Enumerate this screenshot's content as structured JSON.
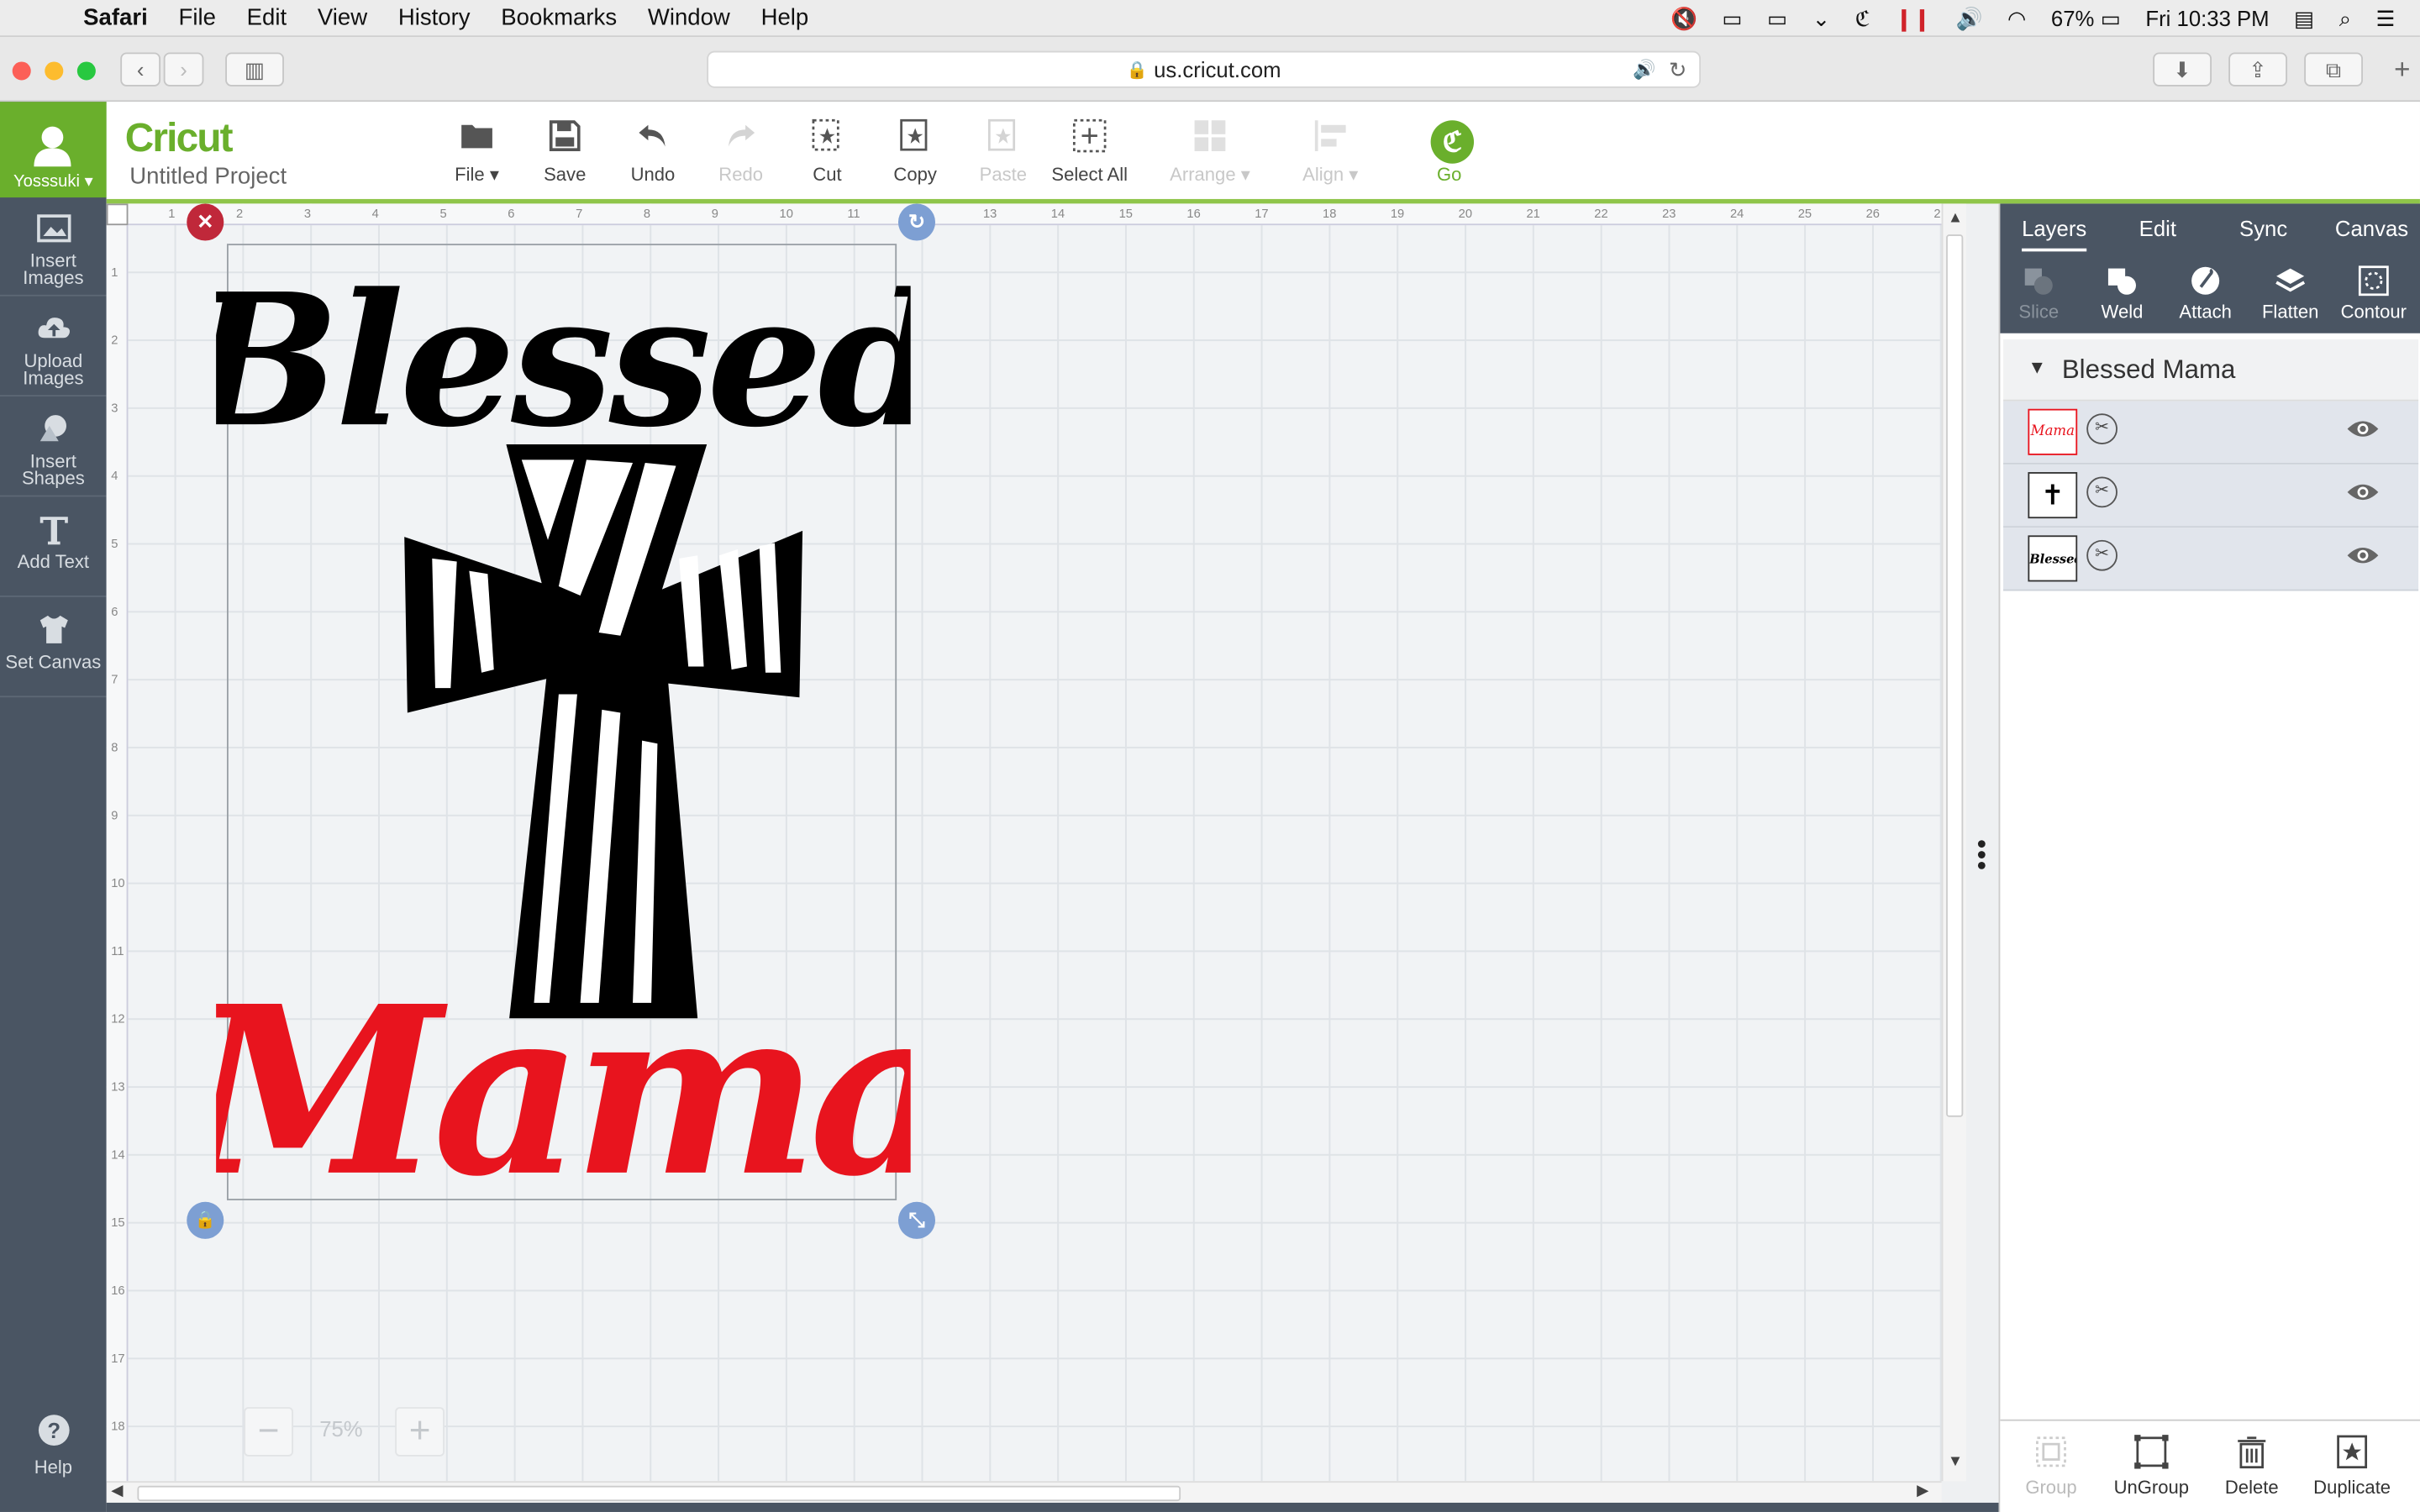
{
  "menubar": {
    "app": "Safari",
    "items": [
      "File",
      "Edit",
      "View",
      "History",
      "Bookmarks",
      "Window",
      "Help"
    ],
    "battery": "67%",
    "clock": "Fri 10:33 PM"
  },
  "browser": {
    "url": "us.cricut.com"
  },
  "sidebar": {
    "username": "Yosssuki",
    "items": [
      {
        "label_line1": "Insert",
        "label_line2": "Images",
        "icon": "image-icon"
      },
      {
        "label_line1": "Upload",
        "label_line2": "Images",
        "icon": "cloud-upload-icon"
      },
      {
        "label_line1": "Insert",
        "label_line2": "Shapes",
        "icon": "shapes-icon"
      },
      {
        "label_line1": "Add Text",
        "label_line2": "",
        "icon": "text-icon"
      },
      {
        "label_line1": "Set Canvas",
        "label_line2": "",
        "icon": "shirt-icon"
      }
    ],
    "help": "Help"
  },
  "header": {
    "brand": "Cricut",
    "project_name": "Untitled Project",
    "tools": [
      {
        "label": "File",
        "enabled": true
      },
      {
        "label": "Save",
        "enabled": true
      },
      {
        "label": "Undo",
        "enabled": true
      },
      {
        "label": "Redo",
        "enabled": false
      },
      {
        "label": "Cut",
        "enabled": true
      },
      {
        "label": "Copy",
        "enabled": true
      },
      {
        "label": "Paste",
        "enabled": false
      },
      {
        "label": "Select All",
        "enabled": true
      },
      {
        "label": "Arrange",
        "enabled": false
      },
      {
        "label": "Align",
        "enabled": false
      }
    ],
    "go_label": "Go"
  },
  "canvas": {
    "design_text_top": "Blessed",
    "design_text_bottom": "Mama",
    "zoom": "75%",
    "ruler_top": [
      "1",
      "2",
      "3",
      "4",
      "5",
      "6",
      "7",
      "8",
      "9",
      "10",
      "11",
      "12",
      "13",
      "14",
      "15",
      "16",
      "17",
      "18",
      "19",
      "20",
      "21",
      "22",
      "23",
      "24",
      "25",
      "26",
      "2"
    ],
    "ruler_left": [
      "1",
      "2",
      "3",
      "4",
      "5",
      "6",
      "7",
      "8",
      "9",
      "10",
      "11",
      "12",
      "13",
      "14",
      "15",
      "16",
      "17",
      "18"
    ]
  },
  "panel": {
    "tabs": [
      "Layers",
      "Edit",
      "Sync",
      "Canvas"
    ],
    "tools": [
      {
        "label": "Slice",
        "enabled": false
      },
      {
        "label": "Weld",
        "enabled": true
      },
      {
        "label": "Attach",
        "enabled": true
      },
      {
        "label": "Flatten",
        "enabled": true
      },
      {
        "label": "Contour",
        "enabled": true
      }
    ],
    "group_name": "Blessed Mama",
    "layers": [
      {
        "thumb_text": "Mama",
        "color": "#e8141e"
      },
      {
        "thumb_text": "✝",
        "color": "#000000"
      },
      {
        "thumb_text": "Blessed",
        "color": "#000000"
      }
    ],
    "bottom_tools": [
      {
        "label": "Group",
        "enabled": false
      },
      {
        "label": "UnGroup",
        "enabled": true
      },
      {
        "label": "Delete",
        "enabled": true
      },
      {
        "label": "Duplicate",
        "enabled": true
      }
    ]
  },
  "colors": {
    "brand_green": "#6aaf2c",
    "sidebar": "#4a5563",
    "design_red": "#e8141e"
  }
}
